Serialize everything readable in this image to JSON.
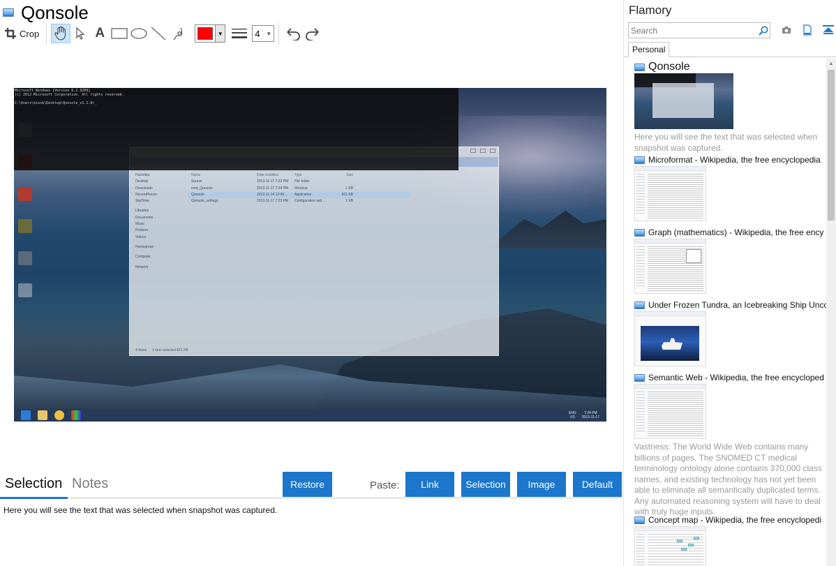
{
  "document": {
    "title": "Qonsole"
  },
  "toolbar": {
    "crop_label": "Crop",
    "text_tool_label": "A",
    "pen_color": "#ff0000",
    "line_width": "4"
  },
  "screenshot": {
    "console_lines": [
      "Microsoft Windows [Version 6.2.9200]",
      "(c) 2012 Microsoft Corporation. All rights reserved.",
      "",
      "C:\\Users\\kiosk\\Desktop\\Qonsole_v1.1.0>_"
    ],
    "explorer": {
      "nav_favorites": [
        "Favorites",
        "Desktop",
        "Downloads",
        "RecentPlaces",
        "SkyDrive"
      ],
      "nav_libraries": [
        "Libraries",
        "Documents",
        "Music",
        "Pictures",
        "Videos"
      ],
      "nav_other": [
        "Homegroup",
        "Computer",
        "Network"
      ],
      "columns": [
        "Name",
        "Date modified",
        "Type",
        "Size"
      ],
      "rows": [
        {
          "name": "Source",
          "date": "2013-11-17 7:23 PM",
          "type": "File folder",
          "size": ""
        },
        {
          "name": "cmd_Qonsole",
          "date": "2013-11-17 7:24 PM",
          "type": "Shortcut",
          "size": "1 KB"
        },
        {
          "name": "Qonsole",
          "date": "2013-11-14 12:46 ...",
          "type": "Application",
          "size": "421 KB"
        },
        {
          "name": "Qonsole_settings",
          "date": "2013-11-17 7:23 PM",
          "type": "Configuration sett...",
          "size": "1 KB"
        }
      ],
      "status_items": "4 items",
      "status_selected": "1 item selected  421 KB"
    },
    "tray": {
      "lang": "ENG",
      "region": "US",
      "time": "7:24 PM",
      "date": "2013-11-17"
    }
  },
  "bottom": {
    "tab_selection": "Selection",
    "tab_notes": "Notes",
    "restore_label": "Restore",
    "paste_label": "Paste:",
    "paste_link": "Link",
    "paste_selection": "Selection",
    "paste_image": "Image",
    "paste_default": "Default",
    "selection_text": "Here you will see the text that was selected when snapshot was captured."
  },
  "sidebar": {
    "title": "Flamory",
    "search_placeholder": "Search",
    "tab": "Personal",
    "items": [
      {
        "title": "Qonsole",
        "desc": "Here you will see the text that was selected when snapshot was captured."
      },
      {
        "title": "Microformat - Wikipedia, the free encyclopedia",
        "desc": ""
      },
      {
        "title": "Graph (mathematics) - Wikipedia, the free ency",
        "desc": ""
      },
      {
        "title": "Under Frozen Tundra, an Icebreaking Ship Unco",
        "desc": ""
      },
      {
        "title": "Semantic Web - Wikipedia, the free encycloped",
        "desc": "Vastness: The World Wide Web contains many billions of pages. The SNOMED CT medical terminology ontology alone contains 370,000 class names, and existing technology has not yet been able to eliminate all semantically duplicated terms. Any automated reasoning system will have to deal with truly huge inputs."
      },
      {
        "title": "Concept map - Wikipedia, the free encyclopedi",
        "desc": ""
      }
    ]
  }
}
